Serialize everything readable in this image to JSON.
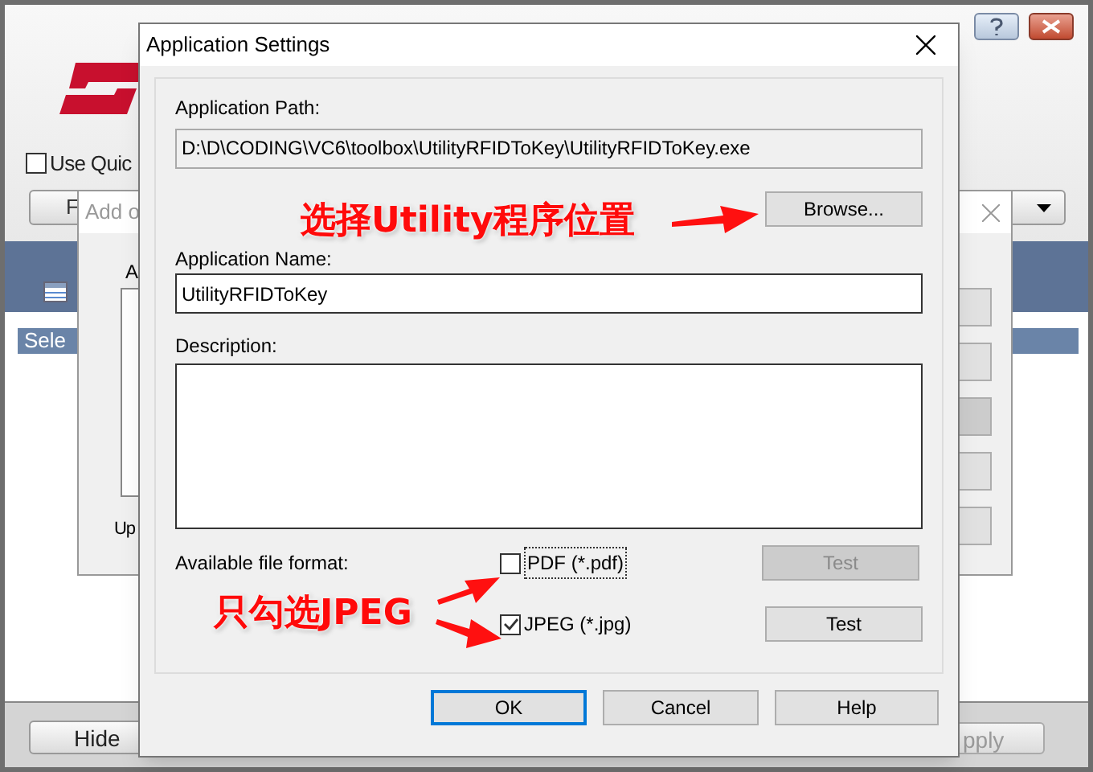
{
  "main_window": {
    "quick_option": {
      "label": "Use Quic",
      "checked": false
    },
    "button_1": "F",
    "list_item": {
      "label": "Sele",
      "selected": true
    },
    "hide_button": "Hide",
    "apply_button": "pply"
  },
  "add_dialog": {
    "title": "Add o",
    "label_1": "A",
    "label_2": "Up"
  },
  "dialog": {
    "title": "Application Settings",
    "path_label": "Application Path:",
    "path_value": "D:\\D\\CODING\\VC6\\toolbox\\UtilityRFIDToKey\\UtilityRFIDToKey.exe",
    "browse_button": "Browse...",
    "name_label": "Application Name:",
    "name_value": "UtilityRFIDToKey",
    "description_label": "Description:",
    "formats_label": "Available file format:",
    "formats": [
      {
        "label": "PDF (*.pdf)",
        "checked": false,
        "focused": true,
        "test_button": {
          "label": "Test",
          "disabled": true
        }
      },
      {
        "label": "JPEG (*.jpg)",
        "checked": true,
        "focused": false,
        "test_button": {
          "label": "Test",
          "disabled": false
        }
      }
    ],
    "buttons": [
      {
        "label": "OK",
        "default": true
      },
      {
        "label": "Cancel",
        "default": false
      },
      {
        "label": "Help",
        "default": false
      }
    ]
  },
  "annotations": [
    {
      "text": "选择Utility程序位置"
    },
    {
      "text": "只勾选JPEG"
    }
  ]
}
